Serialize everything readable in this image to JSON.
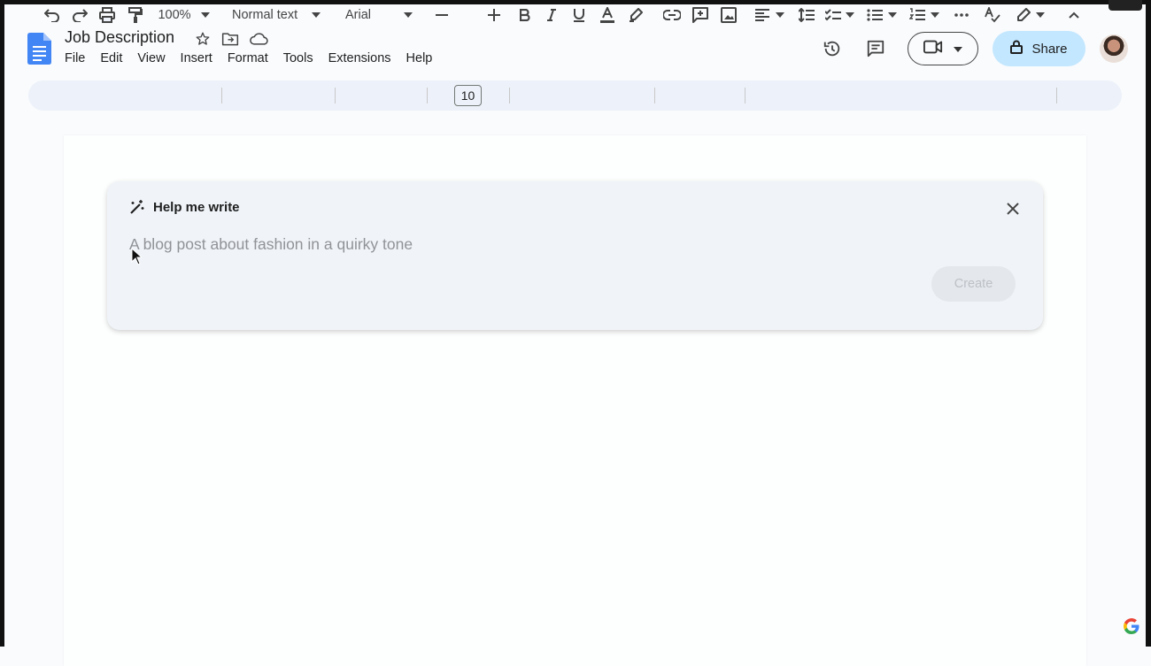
{
  "document": {
    "title": "Job Description"
  },
  "menu": [
    "File",
    "Edit",
    "View",
    "Insert",
    "Format",
    "Tools",
    "Extensions",
    "Help"
  ],
  "header": {
    "share_label": "Share"
  },
  "toolbar": {
    "zoom": "100%",
    "style": "Normal text",
    "font": "Arial",
    "font_size": "10"
  },
  "help_me_write": {
    "title": "Help me write",
    "placeholder": "A blog post about fashion in a quirky tone",
    "create_label": "Create"
  },
  "colors": {
    "accent_share": "#c2e7ff",
    "toolbar_bg": "#edf2fa",
    "docs_blue": "#4285f4"
  }
}
